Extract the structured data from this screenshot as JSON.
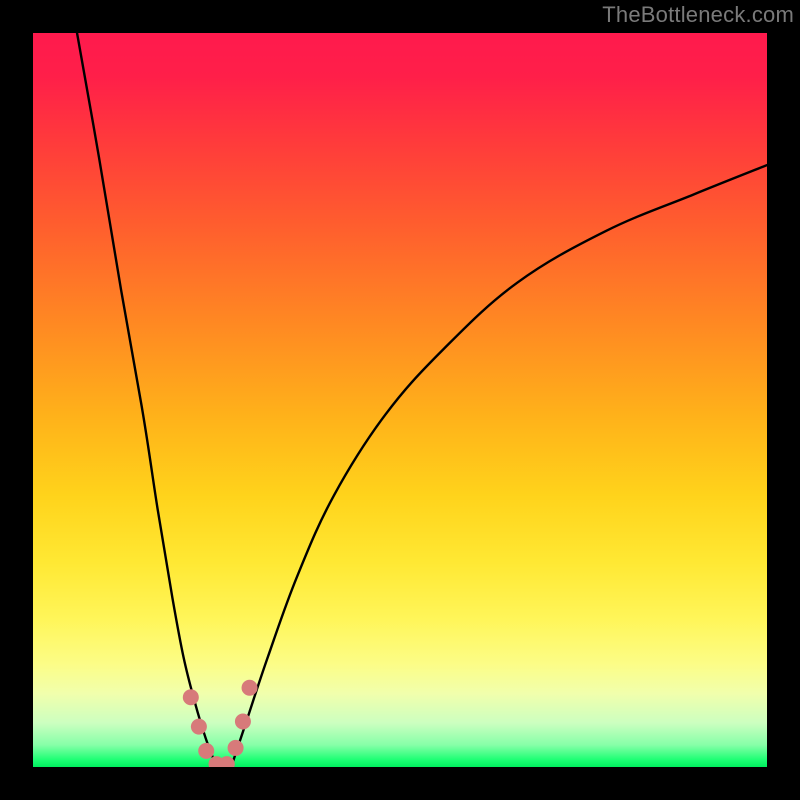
{
  "watermark": "TheBottleneck.com",
  "chart_data": {
    "type": "line",
    "title": "",
    "xlabel": "",
    "ylabel": "",
    "xlim": [
      0,
      100
    ],
    "ylim": [
      0,
      100
    ],
    "grid": false,
    "legend": false,
    "gradient_stops": [
      {
        "pos": 0,
        "color": "#ff1a4d"
      },
      {
        "pos": 15,
        "color": "#ff3b3b"
      },
      {
        "pos": 40,
        "color": "#ff8a22"
      },
      {
        "pos": 63,
        "color": "#ffd31b"
      },
      {
        "pos": 80,
        "color": "#fff65a"
      },
      {
        "pos": 94,
        "color": "#ccffc0"
      },
      {
        "pos": 100,
        "color": "#00ef5e"
      }
    ],
    "series": [
      {
        "name": "left-branch",
        "x": [
          6,
          9,
          12,
          15,
          17,
          19,
          20.5,
          22,
          23.5,
          25
        ],
        "y": [
          100,
          83,
          65,
          48,
          35,
          23,
          15,
          9,
          4,
          0
        ]
      },
      {
        "name": "right-branch",
        "x": [
          27,
          29,
          32,
          36,
          41,
          48,
          56,
          66,
          78,
          90,
          100
        ],
        "y": [
          0,
          6,
          15,
          26,
          37,
          48,
          57,
          66,
          73,
          78,
          82
        ]
      }
    ],
    "markers": {
      "name": "valley-pink-dots",
      "color": "#d77a7a",
      "radius_px": 8,
      "points": [
        {
          "x": 21.5,
          "y": 9.5
        },
        {
          "x": 22.6,
          "y": 5.5
        },
        {
          "x": 23.6,
          "y": 2.2
        },
        {
          "x": 25.0,
          "y": 0.4
        },
        {
          "x": 26.4,
          "y": 0.4
        },
        {
          "x": 27.6,
          "y": 2.6
        },
        {
          "x": 28.6,
          "y": 6.2
        },
        {
          "x": 29.5,
          "y": 10.8
        }
      ]
    }
  }
}
